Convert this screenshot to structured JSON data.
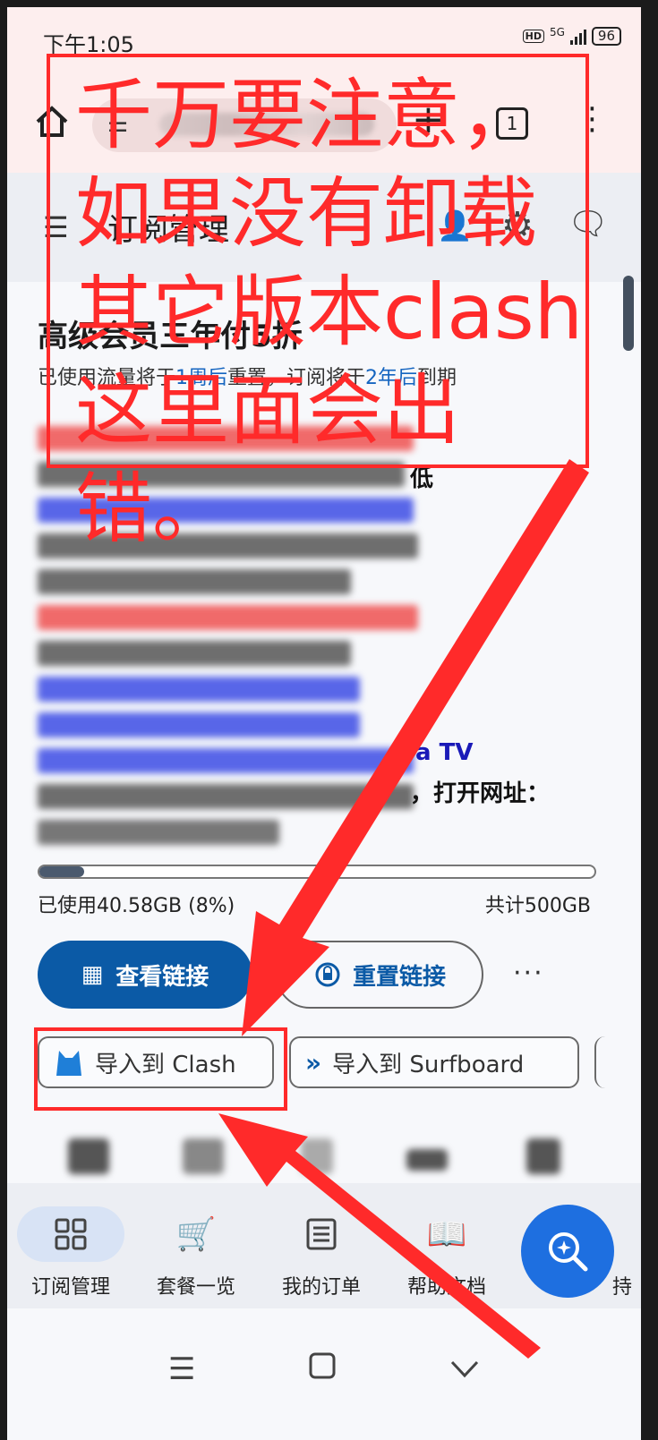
{
  "status": {
    "time": "下午1:05",
    "network": "5G",
    "hd": "HD",
    "battery": "96"
  },
  "browser": {
    "tab_count": "1"
  },
  "header": {
    "title": "订阅管理"
  },
  "card": {
    "title": "高级会员三年付5折",
    "sub_prefix": "已使用流量将于",
    "sub_link1": "1周后",
    "sub_mid": "重置，订阅将于",
    "sub_link2": "2年后",
    "sub_suffix": "到期",
    "visible_fragments": {
      "line2": "低",
      "line9": "a TV",
      "line10": "，打开网址："
    }
  },
  "usage": {
    "used": "已使用40.58GB (8%)",
    "total": "共计500GB",
    "percent": 8
  },
  "actions": {
    "view_link": "查看链接",
    "reset_link": "重置链接",
    "more": "···"
  },
  "imports": {
    "clash": "导入到 Clash",
    "surfboard": "导入到 Surfboard"
  },
  "nav": {
    "items": [
      {
        "label": "订阅管理",
        "icon": "grid-icon"
      },
      {
        "label": "套餐一览",
        "icon": "cart-icon"
      },
      {
        "label": "我的订单",
        "icon": "list-icon"
      },
      {
        "label": "帮助文档",
        "icon": "book-icon"
      },
      {
        "label": "持",
        "icon": "support-icon"
      }
    ]
  },
  "annotation": {
    "text": "千万要注意，\n如果没有卸载\n其它版本clash\n这里面会出错。",
    "color": "#ff2a2a"
  },
  "colors": {
    "primary": "#0b5aa6",
    "fab": "#1e6fe0",
    "accent_red": "#ff2a2a"
  }
}
